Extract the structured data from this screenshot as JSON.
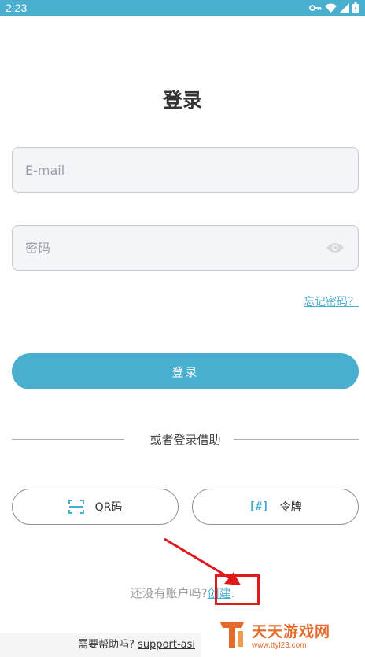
{
  "status_bar": {
    "time": "2:23",
    "icons": [
      "key-icon",
      "wifi-icon",
      "signal-icon",
      "battery-icon"
    ]
  },
  "login": {
    "title": "登录",
    "email_placeholder": "E-mail",
    "password_placeholder": "密码",
    "forgot_password": "忘记密码？",
    "login_button": "登录",
    "divider_text": "或者登录借助",
    "qr_label": "QR码",
    "token_label": "令牌",
    "token_glyph": "[#]",
    "signup_prompt": "还没有账户吗?",
    "signup_link": "创建",
    "signup_suffix": "."
  },
  "help": {
    "prompt": "需要帮助吗?",
    "link": "support-asi"
  },
  "watermark": {
    "title": "天天游戏网",
    "url": "www.ttyl23.com"
  },
  "colors": {
    "accent": "#4aafcf",
    "annotation": "#e01a1a",
    "watermark": "#e56a2a"
  }
}
